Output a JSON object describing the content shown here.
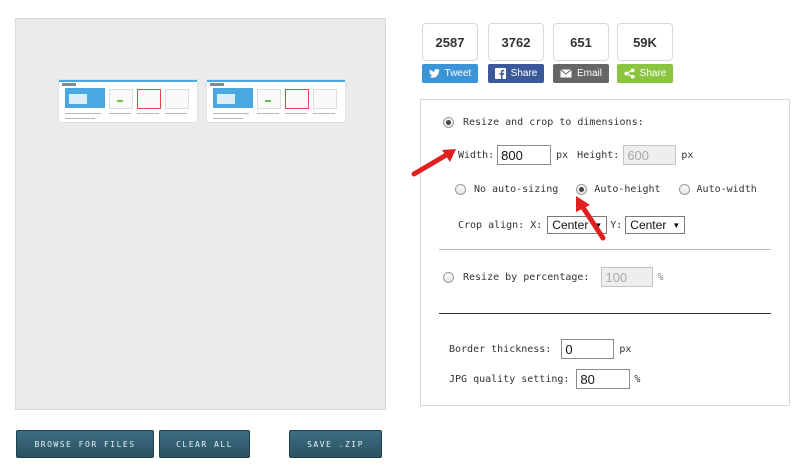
{
  "preview": {
    "thumb_colors": {
      "hero": "#4aa8e0",
      "accent_red": "#e04848",
      "accent_green": "#6bbf4e"
    }
  },
  "buttons": {
    "browse": "BROWSE FOR FILES",
    "clear": "CLEAR ALL",
    "save": "SAVE .ZIP"
  },
  "share": [
    {
      "count": "2587",
      "label": "Tweet",
      "icon": "twitter-icon",
      "color": "#3a94d6"
    },
    {
      "count": "3762",
      "label": "Share",
      "icon": "facebook-icon",
      "color": "#3b5998"
    },
    {
      "count": "651",
      "label": "Email",
      "icon": "email-icon",
      "color": "#666666"
    },
    {
      "count": "59K",
      "label": "Share",
      "icon": "share-icon",
      "color": "#8bc53f"
    }
  ],
  "options": {
    "resize_crop_label": "Resize and crop to dimensions:",
    "width_label": "Width:",
    "width_value": "800",
    "px1": "px",
    "height_label": "Height:",
    "height_value": "600",
    "px2": "px",
    "no_auto_label": "No auto-sizing",
    "auto_height_label": "Auto-height",
    "auto_width_label": "Auto-width",
    "crop_align_label": "Crop align: X:",
    "crop_x_value": "Center",
    "y_label": "Y:",
    "crop_y_value": "Center",
    "resize_pct_label": "Resize by percentage:",
    "pct_value": "100",
    "pct_unit": "%",
    "border_label": "Border thickness:",
    "border_value": "0",
    "px3": "px",
    "jpg_label": "JPG quality setting:",
    "jpg_value": "80",
    "jpg_unit": "%"
  },
  "annotation_color": "#e02020"
}
